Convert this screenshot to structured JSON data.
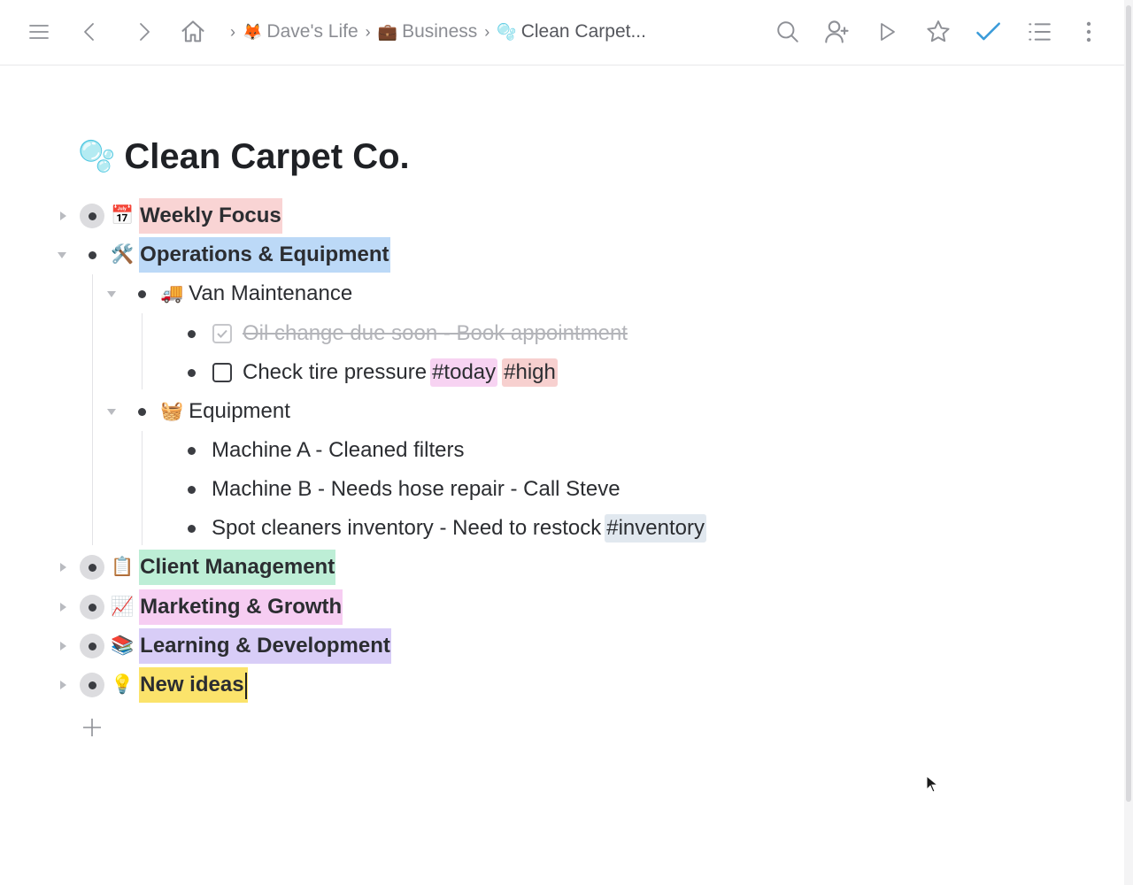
{
  "breadcrumb": {
    "items": [
      {
        "emoji": "🦊",
        "label": "Dave's Life"
      },
      {
        "emoji": "💼",
        "label": "Business"
      },
      {
        "emoji": "🫧",
        "label": "Clean Carpet..."
      }
    ]
  },
  "toolbar": {
    "icons": [
      "menu-icon",
      "back-icon",
      "forward-icon",
      "home-icon",
      "search-icon",
      "add-person-icon",
      "play-icon",
      "star-icon",
      "check-icon",
      "list-icon",
      "more-icon"
    ],
    "accent": "#3a9bd9"
  },
  "document": {
    "emoji": "🫧",
    "title": "Clean Carpet Co."
  },
  "outline": {
    "weekly_focus": {
      "emoji": "📅",
      "label": "Weekly Focus",
      "color": "#f9d4d4"
    },
    "operations": {
      "emoji": "🛠️",
      "label": "Operations & Equipment",
      "color": "#bcd9f7"
    },
    "van": {
      "emoji": "🚚",
      "label": "Van Maintenance"
    },
    "oil_change": {
      "label": "Oil change due soon - Book appointment",
      "checked": true
    },
    "tire_pressure": {
      "label": "Check tire pressure",
      "checked": false,
      "tags": [
        "#today",
        "#high"
      ]
    },
    "equipment": {
      "emoji": "🧺",
      "label": "Equipment"
    },
    "machine_a": {
      "label": "Machine A - Cleaned filters"
    },
    "machine_b": {
      "label": "Machine B - Needs hose repair - Call Steve"
    },
    "spot_cleaners": {
      "label": "Spot cleaners inventory - Need to restock",
      "tag": "#inventory"
    },
    "client": {
      "emoji": "📋",
      "label": "Client Management",
      "color": "#bdeed6"
    },
    "marketing": {
      "emoji": "📈",
      "label": "Marketing & Growth",
      "color": "#f6cdf2"
    },
    "learning": {
      "emoji": "📚",
      "label": "Learning & Development",
      "color": "#d8cdf7"
    },
    "ideas": {
      "emoji": "💡",
      "label": "New ideas",
      "color": "#fbe36b"
    }
  },
  "tag_colors": {
    "#today": "#f7d3f2",
    "#high": "#f7d0cf",
    "#inventory": "#e1e8ef"
  }
}
